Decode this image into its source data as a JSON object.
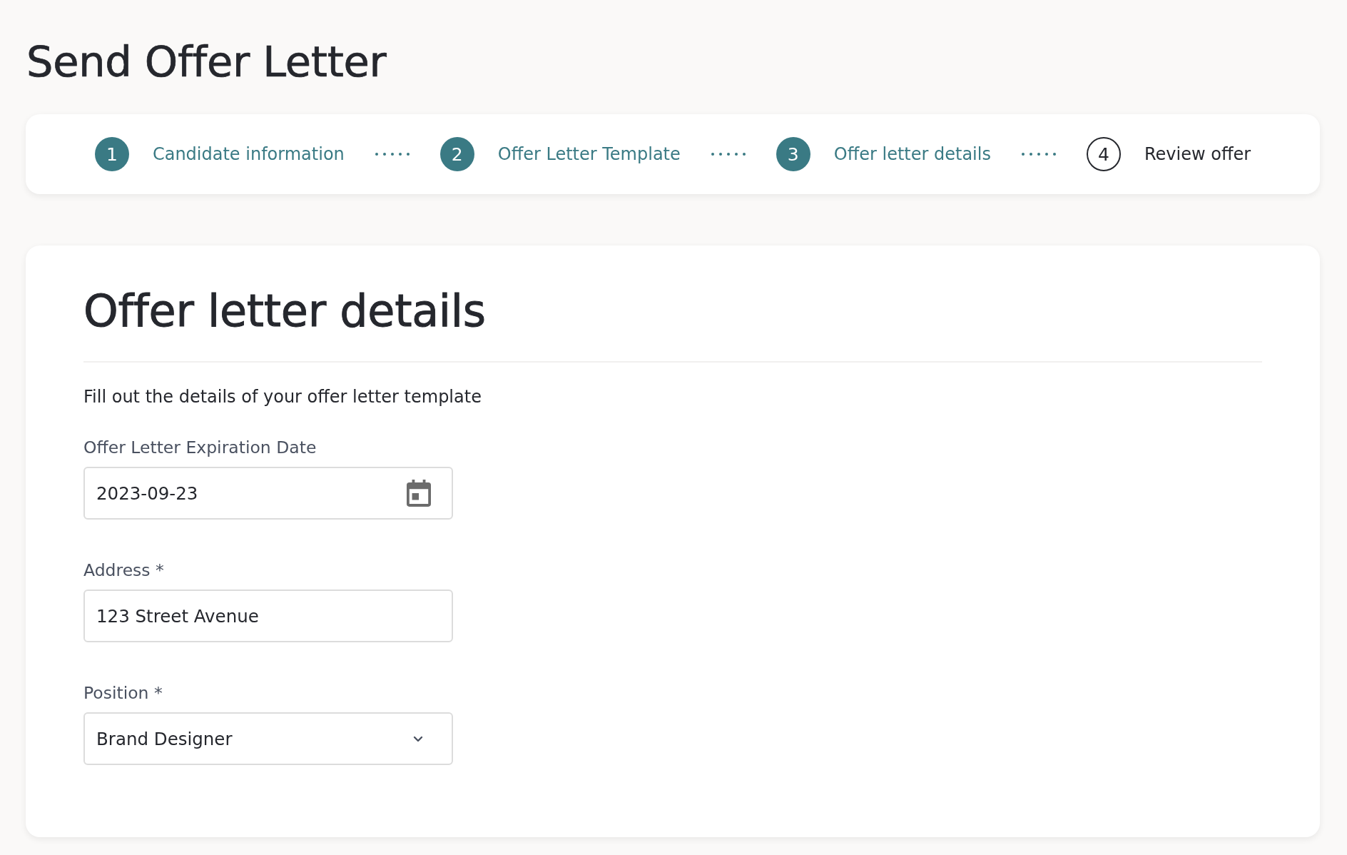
{
  "page": {
    "title": "Send Offer Letter"
  },
  "stepper": {
    "steps": [
      {
        "number": "1",
        "label": "Candidate information",
        "active": true
      },
      {
        "number": "2",
        "label": "Offer Letter Template",
        "active": true
      },
      {
        "number": "3",
        "label": "Offer letter details",
        "active": true
      },
      {
        "number": "4",
        "label": "Review offer",
        "active": false
      }
    ]
  },
  "form": {
    "title": "Offer letter details",
    "description": "Fill out the details of your offer letter template",
    "fields": [
      {
        "kind": "date",
        "label": "Offer Letter Expiration Date",
        "value": "2023-09-23"
      },
      {
        "kind": "text",
        "label": "Address *",
        "value": "123 Street Avenue"
      },
      {
        "kind": "select",
        "label": "Position *",
        "value": "Brand Designer"
      }
    ]
  }
}
